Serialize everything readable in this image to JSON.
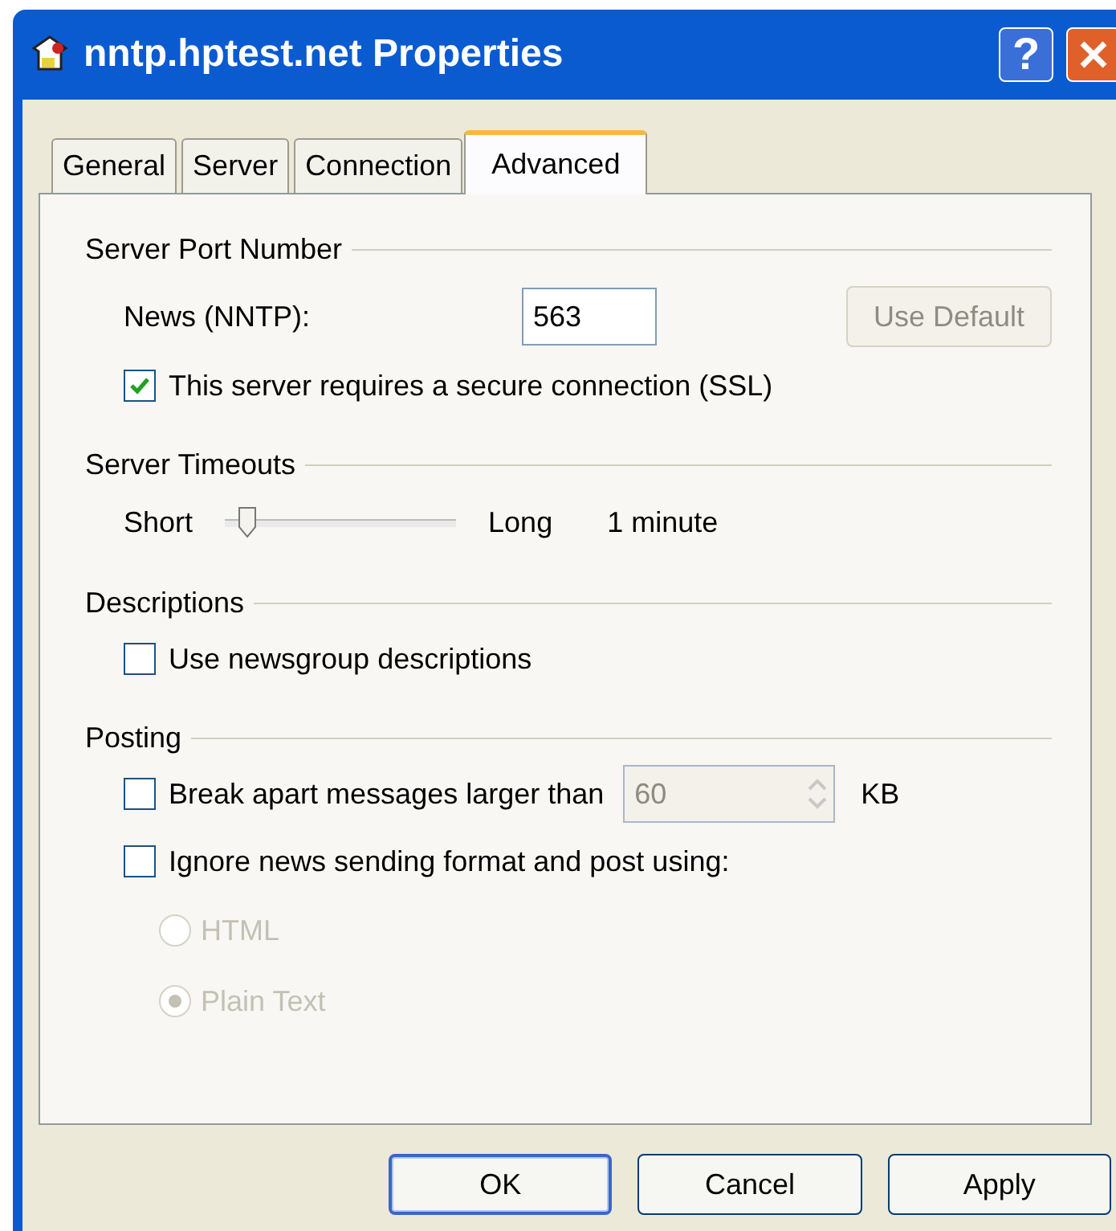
{
  "window": {
    "title": "nntp.hptest.net Properties",
    "help_label": "?"
  },
  "tabs": [
    {
      "label": "General",
      "selected": false
    },
    {
      "label": "Server",
      "selected": false
    },
    {
      "label": "Connection",
      "selected": false
    },
    {
      "label": "Advanced",
      "selected": true
    }
  ],
  "sections": [
    {
      "title": "Server Port Number",
      "rows": [
        {
          "kind": "port",
          "label": "News (NNTP):",
          "value": "563",
          "button": "Use Default",
          "button_disabled": true
        },
        {
          "kind": "checkbox",
          "label": "This server requires a secure connection (SSL)",
          "checked": true
        }
      ]
    },
    {
      "title": "Server Timeouts",
      "rows": [
        {
          "kind": "slider",
          "min_label": "Short",
          "max_label": "Long",
          "level": 0.1,
          "reading": "1 minute"
        }
      ]
    },
    {
      "title": "Descriptions",
      "rows": [
        {
          "kind": "checkbox",
          "label": "Use newsgroup descriptions",
          "checked": false
        }
      ]
    },
    {
      "title": "Posting",
      "rows": [
        {
          "kind": "spin",
          "label": "Break apart messages larger than",
          "checked": false,
          "value": "60",
          "unit": "KB",
          "disabled": true
        },
        {
          "kind": "checkbox",
          "label": "Ignore news sending format and post using:",
          "checked": false
        },
        {
          "kind": "radio",
          "label": "HTML",
          "selected": false,
          "disabled": true
        },
        {
          "kind": "radio",
          "label": "Plain Text",
          "selected": true,
          "disabled": true
        }
      ]
    }
  ],
  "buttons": [
    {
      "label": "OK",
      "default": true
    },
    {
      "label": "Cancel",
      "default": false
    },
    {
      "label": "Apply",
      "default": false
    }
  ]
}
